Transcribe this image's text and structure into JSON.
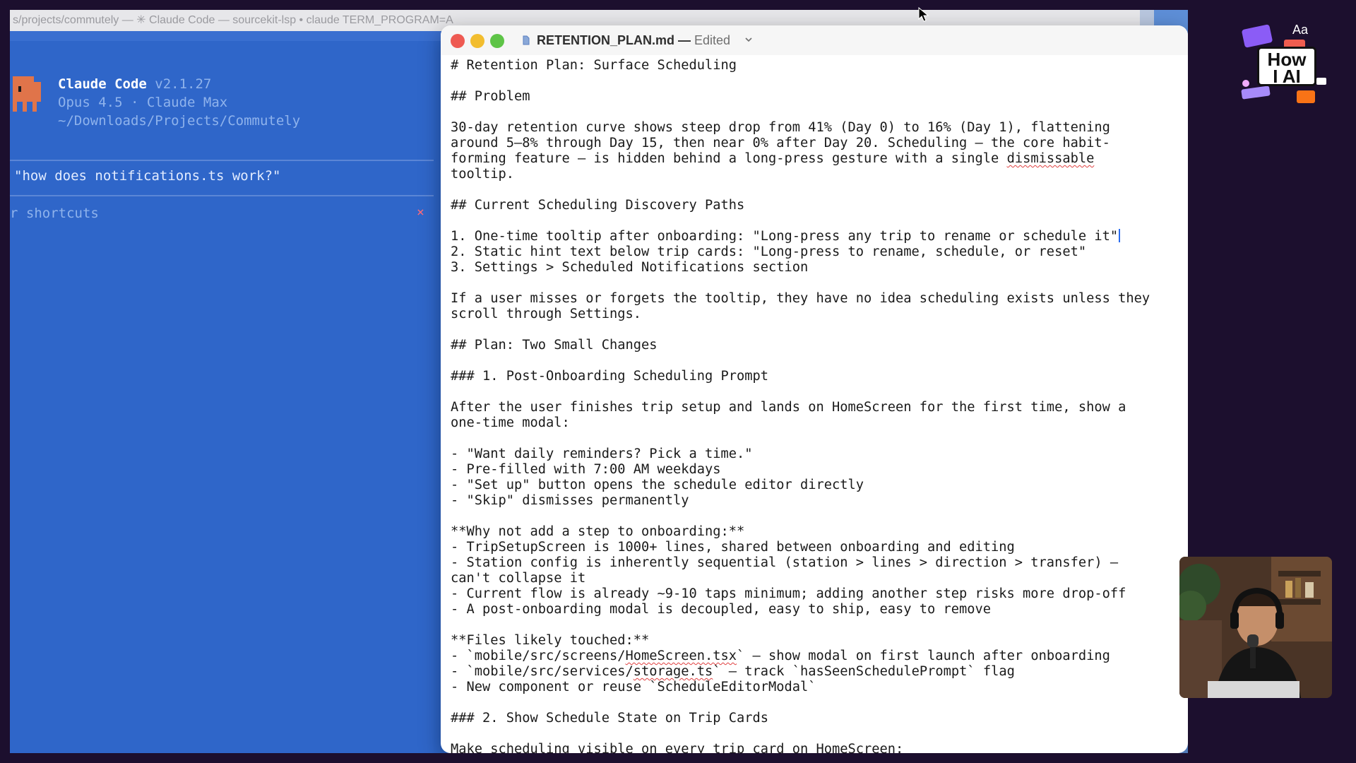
{
  "terminal": {
    "titlebar": "s/projects/commutely — ✳ Claude Code — sourcekit-lsp • claude TERM_PROGRAM=A",
    "app_name": "Claude Code",
    "version": "v2.1.27",
    "model_line": "Opus 4.5 · Claude Max",
    "path": "~/Downloads/Projects/Commutely",
    "prompt_suggestion": "\"how does notifications.ts work?\"",
    "shortcuts_hint": "r shortcuts",
    "shortcuts_close": "×"
  },
  "editor": {
    "filename": "RETENTION_PLAN.md",
    "separator": " — ",
    "status": "Edited",
    "lines": [
      {
        "segs": [
          {
            "t": "# Retention Plan: Surface Scheduling"
          }
        ]
      },
      {
        "segs": []
      },
      {
        "segs": [
          {
            "t": "## Problem"
          }
        ]
      },
      {
        "segs": []
      },
      {
        "segs": [
          {
            "t": "30-day retention curve shows steep drop from 41% (Day 0) to 16% (Day 1), flattening"
          }
        ]
      },
      {
        "segs": [
          {
            "t": "around 5–8% through Day 15, then near 0% after Day 20. Scheduling — the core habit-"
          }
        ]
      },
      {
        "segs": [
          {
            "t": "forming feature — is hidden behind a long-press gesture with a single "
          },
          {
            "t": "dismissable",
            "s": true
          }
        ]
      },
      {
        "segs": [
          {
            "t": "tooltip."
          }
        ]
      },
      {
        "segs": []
      },
      {
        "segs": [
          {
            "t": "## Current Scheduling Discovery Paths"
          }
        ]
      },
      {
        "segs": []
      },
      {
        "segs": [
          {
            "t": "1. One-time tooltip after onboarding: \"Long-press any trip to rename or schedule it\""
          }
        ],
        "caret": true
      },
      {
        "segs": [
          {
            "t": "2. Static hint text below trip cards: \"Long-press to rename, schedule, or reset\""
          }
        ]
      },
      {
        "segs": [
          {
            "t": "3. Settings > Scheduled Notifications section"
          }
        ]
      },
      {
        "segs": []
      },
      {
        "segs": [
          {
            "t": "If a user misses or forgets the tooltip, they have no idea scheduling exists unless they"
          }
        ]
      },
      {
        "segs": [
          {
            "t": "scroll through Settings."
          }
        ]
      },
      {
        "segs": []
      },
      {
        "segs": [
          {
            "t": "## Plan: Two Small Changes"
          }
        ]
      },
      {
        "segs": []
      },
      {
        "segs": [
          {
            "t": "### 1. Post-Onboarding Scheduling Prompt"
          }
        ]
      },
      {
        "segs": []
      },
      {
        "segs": [
          {
            "t": "After the user finishes trip setup and lands on HomeScreen for the first time, show a"
          }
        ]
      },
      {
        "segs": [
          {
            "t": "one-time modal:"
          }
        ]
      },
      {
        "segs": []
      },
      {
        "segs": [
          {
            "t": "- \"Want daily reminders? Pick a time.\""
          }
        ]
      },
      {
        "segs": [
          {
            "t": "- Pre-filled with 7:00 AM weekdays"
          }
        ]
      },
      {
        "segs": [
          {
            "t": "- \"Set up\" button opens the schedule editor directly"
          }
        ]
      },
      {
        "segs": [
          {
            "t": "- \"Skip\" dismisses permanently"
          }
        ]
      },
      {
        "segs": []
      },
      {
        "segs": [
          {
            "t": "**Why not add a step to onboarding:**"
          }
        ]
      },
      {
        "segs": [
          {
            "t": "- TripSetupScreen is 1000+ lines, shared between onboarding and editing"
          }
        ]
      },
      {
        "segs": [
          {
            "t": "- Station config is inherently sequential (station > lines > direction > transfer) —"
          }
        ]
      },
      {
        "segs": [
          {
            "t": "can't collapse it"
          }
        ]
      },
      {
        "segs": [
          {
            "t": "- Current flow is already ~9-10 taps minimum; adding another step risks more drop-off"
          }
        ]
      },
      {
        "segs": [
          {
            "t": "- A post-onboarding modal is decoupled, easy to ship, easy to remove"
          }
        ]
      },
      {
        "segs": []
      },
      {
        "segs": [
          {
            "t": "**Files likely touched:**"
          }
        ]
      },
      {
        "segs": [
          {
            "t": "- `mobile/src/screens/"
          },
          {
            "t": "HomeScreen.tsx",
            "s": true
          },
          {
            "t": "` — show modal on first launch after onboarding"
          }
        ]
      },
      {
        "segs": [
          {
            "t": "- `mobile/src/services/"
          },
          {
            "t": "storage.ts",
            "s": true
          },
          {
            "t": "` — track `hasSeenSchedulePrompt` flag"
          }
        ]
      },
      {
        "segs": [
          {
            "t": "- New component or reuse `ScheduleEditorModal`"
          }
        ]
      },
      {
        "segs": []
      },
      {
        "segs": [
          {
            "t": "### 2. Show Schedule State on Trip Cards"
          }
        ]
      },
      {
        "segs": []
      },
      {
        "segs": [
          {
            "t": "Make scheduling visible on every trip card on HomeScreen:"
          }
        ]
      }
    ]
  },
  "logo": {
    "corner": "Aa",
    "line1": "How",
    "line2": "I AI"
  },
  "colors": {
    "terminal_bg": "#2f66c9",
    "close": "#ee5a52",
    "minimize": "#f2bd2f",
    "maximize": "#5ec447",
    "caret": "#2a6cf0"
  }
}
